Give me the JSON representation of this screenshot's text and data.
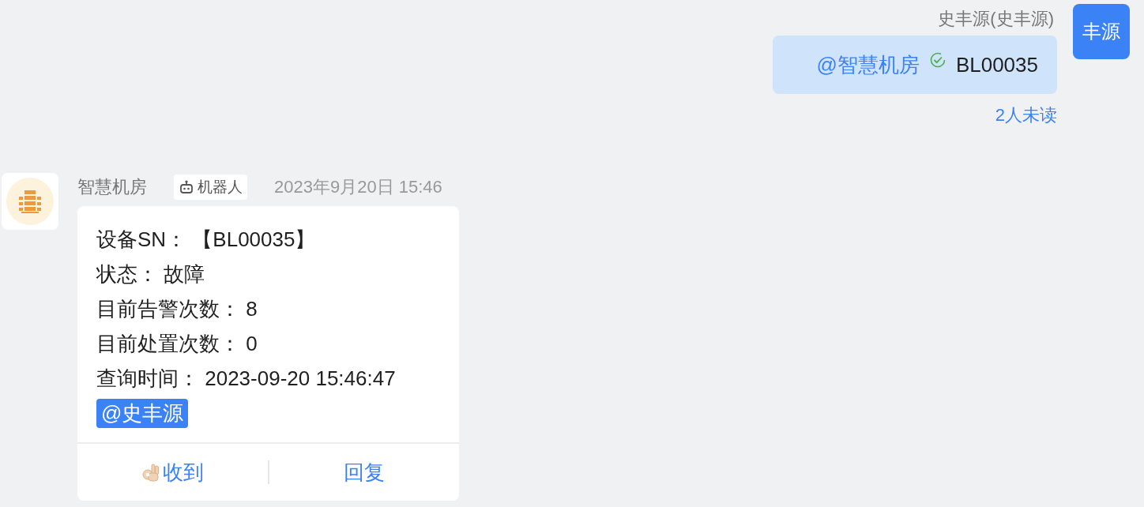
{
  "outgoing": {
    "sender": "史丰源(史丰源)",
    "avatar_text": "丰源",
    "mention": "@智慧机房",
    "text": "BL00035",
    "read_status": "2人未读"
  },
  "incoming": {
    "sender": "智慧机房",
    "tag": "机器人",
    "time": "2023年9月20日 15:46",
    "lines": [
      "设备SN： 【BL00035】",
      "状态： 故障",
      "目前告警次数： 8",
      "目前处置次数： 0",
      "查询时间： 2023-09-20 15:46:47"
    ],
    "mention": "@史丰源",
    "actions": [
      {
        "kind": "ok",
        "label": "收到"
      },
      {
        "kind": "plain",
        "label": "回复"
      }
    ]
  }
}
